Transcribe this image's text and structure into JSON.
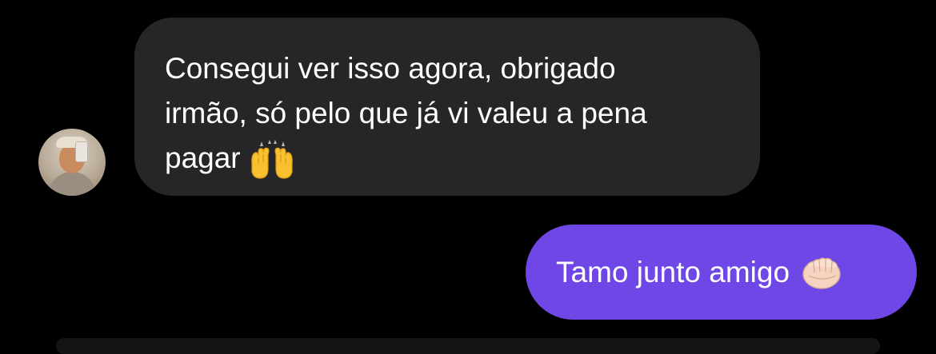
{
  "conversation": {
    "incoming": {
      "avatar_icon": "user-avatar-icon",
      "lines": [
        "Consegui ver isso agora, obrigado",
        "irmão, só pelo que já vi valeu a pena",
        "pagar"
      ],
      "emoji": "raising-hands-emoji",
      "bubble_color": "#262628"
    },
    "outgoing": {
      "text": "Tamo junto amigo",
      "emoji": "fist-bump-emoji",
      "bubble_color": "#6e47e6"
    }
  }
}
